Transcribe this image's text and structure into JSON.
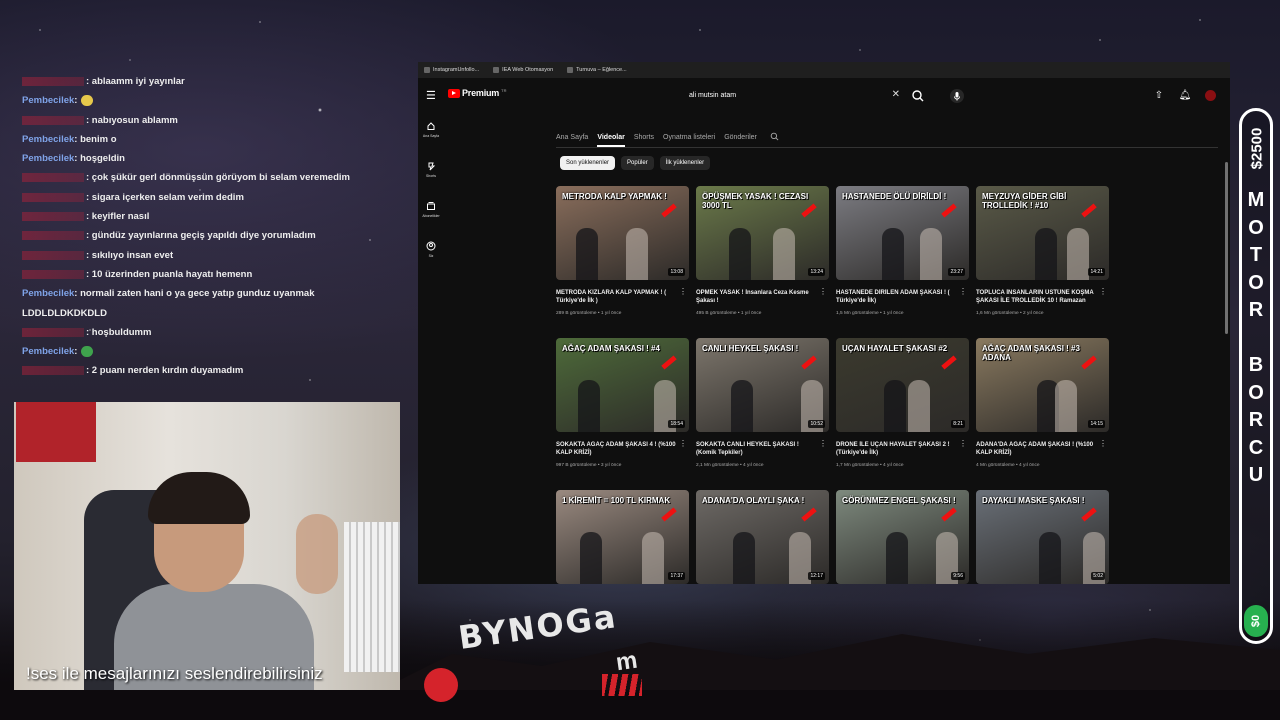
{
  "chat": [
    {
      "user": "",
      "user_color": "#a3213a",
      "text": ": ablaamm iyi yayınlar"
    },
    {
      "user": "Pembecilek",
      "user_color": "#7fa3e8",
      "text": ":",
      "emote": "#e6c84b"
    },
    {
      "user": "",
      "user_color": "#a3213a",
      "text": ": nabıyosun ablamm"
    },
    {
      "user": "Pembecilek",
      "user_color": "#7fa3e8",
      "text": ": benim o"
    },
    {
      "user": "Pembecilek",
      "user_color": "#7fa3e8",
      "text": ": hoşgeldin"
    },
    {
      "user": "",
      "user_color": "#a3213a",
      "text": ": çok şükür gerl dönmüşsün görüyom bi selam veremedim"
    },
    {
      "user": "",
      "user_color": "#a3213a",
      "text": ": sigara içerken selam verim dedim"
    },
    {
      "user": "",
      "user_color": "#a3213a",
      "text": ": keyifler nasıl"
    },
    {
      "user": "",
      "user_color": "#a3213a",
      "text": ": gündüz yayınlarına geçiş yapıldı diye yorumladım"
    },
    {
      "user": "",
      "user_color": "#a3213a",
      "text": ": sıkılıyo insan evet"
    },
    {
      "user": "",
      "user_color": "#a3213a",
      "text": ": 10 üzerinden puanla hayatı hemenn"
    },
    {
      "user": "Pembecilek",
      "user_color": "#7fa3e8",
      "text": ": normali zaten hani o ya gece yatıp gunduz uyanmak"
    },
    {
      "user": "",
      "user_color": "#a3213a",
      "text": "LDDLDLDKDKDLD"
    },
    {
      "user": "",
      "user_color": "#a3213a",
      "text": ": hoşbuldumm"
    },
    {
      "user": "Pembecilek",
      "user_color": "#7fa3e8",
      "text": ":",
      "emote": "#3fa34d"
    },
    {
      "user": "",
      "user_color": "#a3213a",
      "text": ": 2 puanı nerden kırdın duyamadım"
    }
  ],
  "tts_text": "!ses ile mesajlarınızı seslendirebilirsiniz",
  "brand": {
    "main": "BYNOGa",
    "sub": "m"
  },
  "goal": {
    "amount": "$2500",
    "letters": [
      "M",
      "O",
      "T",
      "O",
      "R",
      "",
      "B",
      "O",
      "R",
      "C",
      "U"
    ],
    "current": "$0",
    "progress": 0
  },
  "browser": {
    "bookmarks": [
      "InstagramUnfollo...",
      "IEA Web Otomasyon",
      "Turnuva – Eğlence..."
    ],
    "logo_text": "Premium",
    "logo_sup": "TR",
    "search_value": "ali mutsin atam",
    "sidebar": [
      {
        "label": "Ana Sayfa",
        "icon": "home-icon"
      },
      {
        "label": "Shorts",
        "icon": "shorts-icon"
      },
      {
        "label": "Abonelikler",
        "icon": "subscriptions-icon"
      },
      {
        "label": "Siz",
        "icon": "you-icon"
      }
    ],
    "tabs": [
      "Ana Sayfa",
      "Videolar",
      "Shorts",
      "Oynatma listeleri",
      "Gönderiler"
    ],
    "active_tab": 1,
    "chips": [
      "Son yüklenenler",
      "Popüler",
      "İlk yüklenenler"
    ],
    "active_chip": 0,
    "videos": [
      {
        "caption": "METRODA KALP YAPMAK !",
        "title": "METRODA KIZLARA KALP YAPMAK ! ( Türkiye'de İlk )",
        "meta": "289 B görüntüleme • 1 yıl önce",
        "duration": "13:08",
        "color": "#8a6e5c"
      },
      {
        "caption": "ÖPÜŞMEK YASAK ! CEZASI 3000 TL",
        "title": "ÖPMEK YASAK ! İnsanlara Ceza Kesme Şakası !",
        "meta": "495 B görüntüleme • 1 yıl önce",
        "duration": "13:24",
        "color": "#6b7a4a"
      },
      {
        "caption": "HASTANEDE ÖLÜ DİRİLDİ !",
        "title": "HASTANEDE DİRİLEN ADAM ŞAKASI ! ( Türkiye'de İlk)",
        "meta": "1,5 Mn görüntüleme • 1 yıl önce",
        "duration": "23:27",
        "color": "#7c7c82"
      },
      {
        "caption": "MEYZUYA GİDER GİBİ TROLLEDİK ! #10",
        "title": "TOPLUCA İNSANLARIN ÜSTÜNE KOŞMA ŞAKASI İLE TROLLEDİK 10 ! Ramazan",
        "meta": "1,6 Mn görüntüleme • 2 yıl önce",
        "duration": "14:21",
        "color": "#5a5a48"
      },
      {
        "caption": "AĞAÇ ADAM ŞAKASI ! #4",
        "title": "SOKAKTA AĞAÇ ADAM ŞAKASI 4 ! (%100 KALP KRİZİ)",
        "meta": "997 B görüntüleme • 3 yıl önce",
        "duration": "18:54",
        "color": "#4e6b3a"
      },
      {
        "caption": "CANLI HEYKEL ŞAKASI !",
        "title": "SOKAKTA CANLI HEYKEL ŞAKASI ! (Komik Tepkiler)",
        "meta": "2,1 Mn görüntüleme • 4 yıl önce",
        "duration": "10:52",
        "color": "#7d766c"
      },
      {
        "caption": "UÇAN HAYALET ŞAKASI #2",
        "title": "DRONE İLE UÇAN HAYALET ŞAKASI 2 ! (Türkiye'de İlk)",
        "meta": "1,7 Mn görüntüleme • 4 yıl önce",
        "duration": "8:21",
        "color": "#3b3a2e"
      },
      {
        "caption": "AĞAÇ ADAM ŞAKASI ! #3 ADANA",
        "title": "ADANA'DA AĞAÇ ADAM ŞAKASI ! (%100 KALP KRİZİ)",
        "meta": "4 Mn görüntüleme • 4 yıl önce",
        "duration": "14:15",
        "color": "#8a7a60"
      },
      {
        "caption": "1 KİREMİT = 100 TL KIRMAK",
        "title": "",
        "meta": "",
        "duration": "17:37",
        "color": "#9a8a80"
      },
      {
        "caption": "ADANA'DA OLAYLI ŞAKA !",
        "title": "",
        "meta": "",
        "duration": "12:17",
        "color": "#6e6a66"
      },
      {
        "caption": "GÖRÜNMEZ ENGEL ŞAKASI !",
        "title": "",
        "meta": "",
        "duration": "9:56",
        "color": "#7e8a7e"
      },
      {
        "caption": "DAYAKLI MASKE ŞAKASI !",
        "title": "",
        "meta": "",
        "duration": "5:02",
        "color": "#6a7078"
      }
    ]
  }
}
